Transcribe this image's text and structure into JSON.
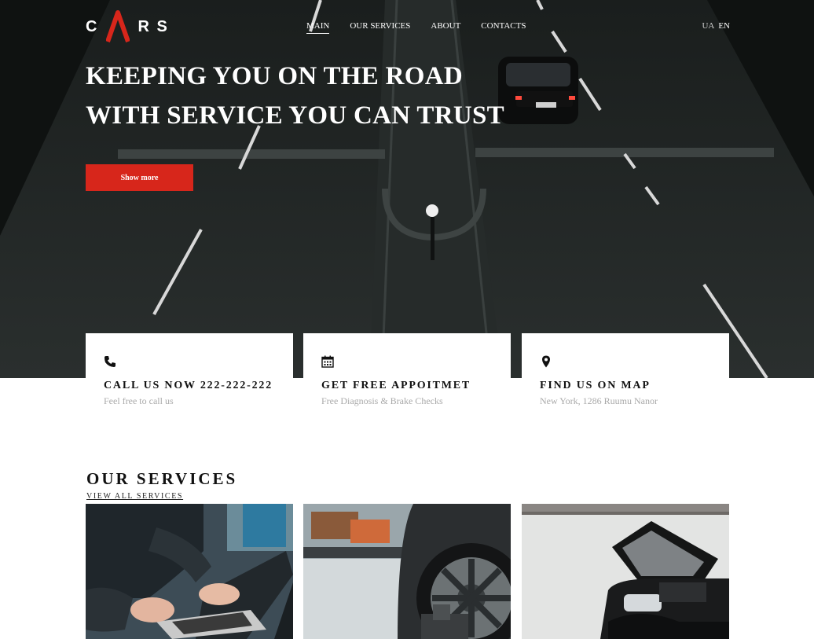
{
  "brand": {
    "logo_text_left": "C",
    "logo_text_right": "R S",
    "logo_accent": "#d7261b"
  },
  "nav": {
    "items": [
      {
        "label": "MAIN",
        "active": true
      },
      {
        "label": "OUR SERVICES",
        "active": false
      },
      {
        "label": "ABOUT",
        "active": false
      },
      {
        "label": "CONTACTS",
        "active": false
      }
    ]
  },
  "lang": {
    "ua": "UA",
    "en": "EN"
  },
  "hero": {
    "line1": "KEEPING YOU ON THE ROAD",
    "line2": "WITH SERVICE YOU CAN TRUST",
    "button": "Show more"
  },
  "cards": [
    {
      "icon": "phone-icon",
      "title": "CALL US NOW 222-222-222",
      "subtitle": "Feel free to call us"
    },
    {
      "icon": "calendar-icon",
      "title": "GET FREE APPOITMET",
      "subtitle": "Free Diagnosis & Brake Checks"
    },
    {
      "icon": "map-pin-icon",
      "title": "FIND US ON MAP",
      "subtitle": "New York, 1286 Ruumu Nanor"
    }
  ],
  "services": {
    "title": "OUR SERVICES",
    "view_all": "VIEW ALL SERVICES"
  },
  "colors": {
    "accent": "#d7261b",
    "hero_dark": "#1c2120"
  }
}
